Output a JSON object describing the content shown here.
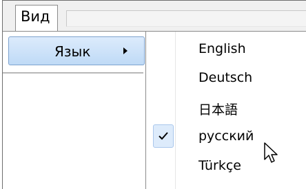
{
  "menubar": {
    "view_menu_label": "Вид"
  },
  "view_menu": {
    "items": [
      {
        "label": "Язык",
        "has_submenu": true,
        "highlighted": true
      }
    ]
  },
  "language_submenu": {
    "items": [
      {
        "label": "English",
        "checked": false
      },
      {
        "label": "Deutsch",
        "checked": false
      },
      {
        "label": "日本語",
        "checked": false
      },
      {
        "label": "русский",
        "checked": true
      },
      {
        "label": "Türkçe",
        "checked": false
      }
    ]
  },
  "icons": {
    "submenu": "chevron-right-icon",
    "check": "checkmark-icon",
    "cursor": "mouse-pointer-icon"
  },
  "colors": {
    "highlight_bg": "#c9e0f9",
    "highlight_border": "#7da2ce"
  }
}
